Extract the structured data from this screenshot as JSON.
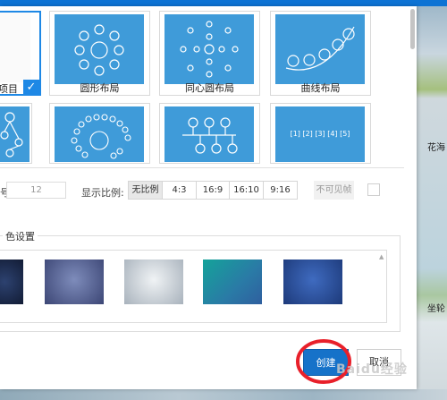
{
  "layouts": [
    {
      "label": "项目",
      "name": "project",
      "selected": true
    },
    {
      "label": "圆形布局",
      "name": "circle",
      "selected": false
    },
    {
      "label": "同心圆布局",
      "name": "concentric",
      "selected": false
    },
    {
      "label": "曲线布局",
      "name": "curve",
      "selected": false
    },
    {
      "label": "",
      "name": "tree",
      "selected": false
    },
    {
      "label": "",
      "name": "spiral",
      "selected": false
    },
    {
      "label": "",
      "name": "org",
      "selected": false
    },
    {
      "label": "",
      "name": "timeline",
      "selected": false
    }
  ],
  "selected_check_icon": "checkmark-icon",
  "settings": {
    "size_label_suffix": "号:",
    "size_value": "12",
    "ratio_label": "显示比例:",
    "ratios": [
      "无比例",
      "4:3",
      "16:9",
      "16:10",
      "9:16"
    ],
    "active_ratio": "无比例",
    "invisible_label": "不可见帧"
  },
  "background": {
    "group_title": "色设置",
    "swatch_colors": [
      "#1c2b4d",
      "#5d6a9a",
      "#c9d0d7",
      "#20979a",
      "#2b5196"
    ]
  },
  "timeline_text": "[1] [2] [3] [4] [5]",
  "buttons": {
    "create": "创建",
    "cancel": "取消"
  },
  "watermark": "Baidu经验",
  "edge_texts": [
    "花海",
    "坐轮"
  ],
  "accent_color": "#1e88e5",
  "tile_color": "#3f9bd9"
}
